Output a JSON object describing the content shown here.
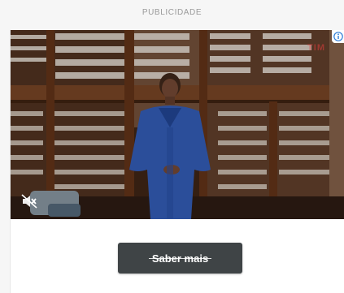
{
  "ad": {
    "label": "PUBLICIDADE",
    "brand_logo_text": "TIM",
    "adchoices_icon": "info-icon",
    "mute_icon": "speaker-muted-icon",
    "cta_label": "Saber mais"
  },
  "colors": {
    "cta_background": "#3f4446",
    "cta_text": "#ffffff",
    "label_text": "#9a9a9a",
    "adchoices_icon": "#2f7ed8"
  }
}
